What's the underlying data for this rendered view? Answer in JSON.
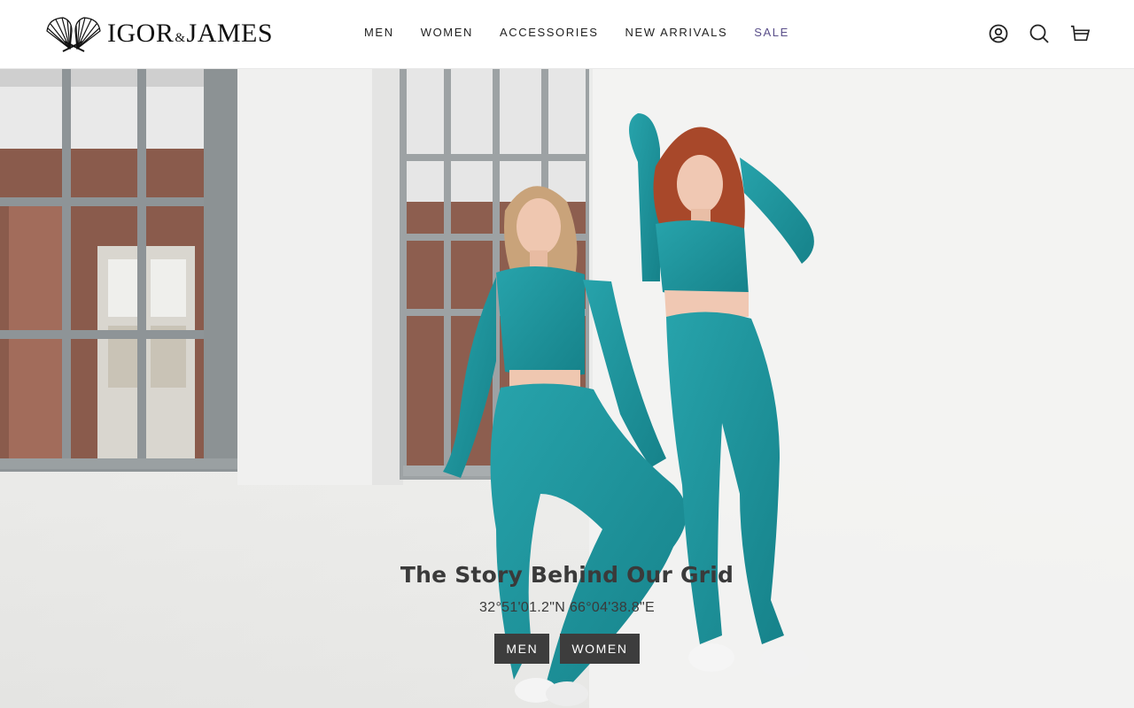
{
  "brand": {
    "name_left": "IGOR",
    "ampersand": "&",
    "name_right": "JAMES",
    "logo_icon": "scallop-fan-icon"
  },
  "nav": {
    "items": [
      {
        "label": "MEN"
      },
      {
        "label": "WOMEN"
      },
      {
        "label": "ACCESSORIES"
      },
      {
        "label": "NEW ARRIVALS"
      },
      {
        "label": "SALE"
      }
    ],
    "sale_color": "#5a4f8a"
  },
  "header_icons": {
    "account": "account-icon",
    "search": "search-icon",
    "cart": "cart-icon"
  },
  "hero": {
    "title": "The Story Behind Our Grid",
    "subtitle": "32°51'01.2\"N 66°04'38.8\"E",
    "buttons": [
      {
        "label": "MEN"
      },
      {
        "label": "WOMEN"
      }
    ],
    "outfit_color": "#1f8f97",
    "button_color": "#3d3d3d"
  }
}
